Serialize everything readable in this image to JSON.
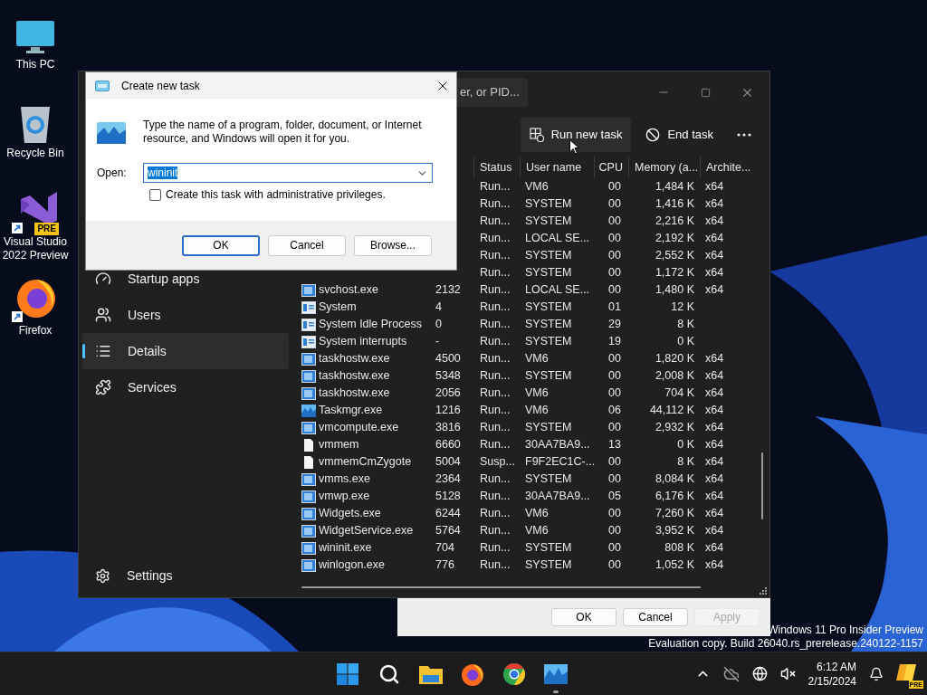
{
  "desktop_icons": [
    {
      "label": "This PC",
      "kind": "pc"
    },
    {
      "label": "Recycle Bin",
      "kind": "bin"
    },
    {
      "label": "Visual Studio 2022 Preview",
      "kind": "vs",
      "badge": "PRE"
    },
    {
      "label": "Firefox",
      "kind": "firefox"
    }
  ],
  "properties_dialog": {
    "buttons": [
      {
        "label": "OK",
        "disabled": false
      },
      {
        "label": "Cancel",
        "disabled": false
      },
      {
        "label": "Apply",
        "disabled": true
      }
    ]
  },
  "watermark": {
    "line1": "Windows 11 Pro Insider Preview",
    "line2": "Evaluation copy. Build 26040.rs_prerelease.240122-1157"
  },
  "task_manager": {
    "search": {
      "placeholder": "er, or PID..."
    },
    "toolbar": [
      {
        "kind": "run",
        "label": "Run new task",
        "hovered": true
      },
      {
        "kind": "end",
        "label": "End task",
        "hovered": false
      },
      {
        "kind": "more",
        "hovered": false
      }
    ],
    "sidebar": {
      "items": [
        {
          "kind": "startup",
          "label": "Startup apps",
          "selected": false
        },
        {
          "kind": "users",
          "label": "Users",
          "selected": false
        },
        {
          "kind": "details",
          "label": "Details",
          "selected": true
        },
        {
          "kind": "services",
          "label": "Services",
          "selected": false
        }
      ],
      "settings": "Settings"
    },
    "table": {
      "columns": [
        "Status",
        "User name",
        "CPU",
        "Memory (a...",
        "Archite..."
      ],
      "rows": [
        {
          "status": "Run...",
          "user": "VM6",
          "cpu": "00",
          "memory": "1,484 K",
          "arch": "x64"
        },
        {
          "status": "Run...",
          "user": "SYSTEM",
          "cpu": "00",
          "memory": "1,416 K",
          "arch": "x64"
        },
        {
          "status": "Run...",
          "user": "SYSTEM",
          "cpu": "00",
          "memory": "2,216 K",
          "arch": "x64"
        },
        {
          "status": "Run...",
          "user": "LOCAL SE...",
          "cpu": "00",
          "memory": "2,192 K",
          "arch": "x64"
        },
        {
          "status": "Run...",
          "user": "SYSTEM",
          "cpu": "00",
          "memory": "2,552 K",
          "arch": "x64"
        },
        {
          "status": "Run...",
          "user": "SYSTEM",
          "cpu": "00",
          "memory": "1,172 K",
          "arch": "x64"
        },
        {
          "kind": "exe",
          "name": "svchost.exe",
          "pid": "2132",
          "status": "Run...",
          "user": "LOCAL SE...",
          "cpu": "00",
          "memory": "1,480 K",
          "arch": "x64"
        },
        {
          "kind": "system",
          "name": "System",
          "pid": "4",
          "status": "Run...",
          "user": "SYSTEM",
          "cpu": "01",
          "memory": "12 K"
        },
        {
          "kind": "system",
          "name": "System Idle Process",
          "pid": "0",
          "status": "Run...",
          "user": "SYSTEM",
          "cpu": "29",
          "memory": "8 K"
        },
        {
          "kind": "system",
          "name": "System interrupts",
          "pid": "-",
          "status": "Run...",
          "user": "SYSTEM",
          "cpu": "19",
          "memory": "0 K"
        },
        {
          "kind": "exe",
          "name": "taskhostw.exe",
          "pid": "4500",
          "status": "Run...",
          "user": "VM6",
          "cpu": "00",
          "memory": "1,820 K",
          "arch": "x64"
        },
        {
          "kind": "exe",
          "name": "taskhostw.exe",
          "pid": "5348",
          "status": "Run...",
          "user": "SYSTEM",
          "cpu": "00",
          "memory": "2,008 K",
          "arch": "x64"
        },
        {
          "kind": "exe",
          "name": "taskhostw.exe",
          "pid": "2056",
          "status": "Run...",
          "user": "VM6",
          "cpu": "00",
          "memory": "704 K",
          "arch": "x64"
        },
        {
          "kind": "taskmgr",
          "name": "Taskmgr.exe",
          "pid": "1216",
          "status": "Run...",
          "user": "VM6",
          "cpu": "06",
          "memory": "44,112 K",
          "arch": "x64"
        },
        {
          "kind": "exe",
          "name": "vmcompute.exe",
          "pid": "3816",
          "status": "Run...",
          "user": "SYSTEM",
          "cpu": "00",
          "memory": "2,932 K",
          "arch": "x64"
        },
        {
          "kind": "file",
          "name": "vmmem",
          "pid": "6660",
          "status": "Run...",
          "user": "30AA7BA9...",
          "cpu": "13",
          "memory": "0 K",
          "arch": "x64"
        },
        {
          "kind": "file",
          "name": "vmmemCmZygote",
          "pid": "5004",
          "status": "Susp...",
          "user": "F9F2EC1C-...",
          "cpu": "00",
          "memory": "8 K",
          "arch": "x64"
        },
        {
          "kind": "exe",
          "name": "vmms.exe",
          "pid": "2364",
          "status": "Run...",
          "user": "SYSTEM",
          "cpu": "00",
          "memory": "8,084 K",
          "arch": "x64"
        },
        {
          "kind": "exe",
          "name": "vmwp.exe",
          "pid": "5128",
          "status": "Run...",
          "user": "30AA7BA9...",
          "cpu": "05",
          "memory": "6,176 K",
          "arch": "x64"
        },
        {
          "kind": "exe",
          "name": "Widgets.exe",
          "pid": "6244",
          "status": "Run...",
          "user": "VM6",
          "cpu": "00",
          "memory": "7,260 K",
          "arch": "x64"
        },
        {
          "kind": "exe",
          "name": "WidgetService.exe",
          "pid": "5764",
          "status": "Run...",
          "user": "VM6",
          "cpu": "00",
          "memory": "3,952 K",
          "arch": "x64"
        },
        {
          "kind": "exe",
          "name": "wininit.exe",
          "pid": "704",
          "status": "Run...",
          "user": "SYSTEM",
          "cpu": "00",
          "memory": "808 K",
          "arch": "x64"
        },
        {
          "kind": "exe",
          "name": "winlogon.exe",
          "pid": "776",
          "status": "Run...",
          "user": "SYSTEM",
          "cpu": "00",
          "memory": "1,052 K",
          "arch": "x64"
        }
      ]
    }
  },
  "run_dialog": {
    "title": "Create new task",
    "message": "Type the name of a program, folder, document, or Internet resource, and Windows will open it for you.",
    "open_label": "Open:",
    "value": "wininit",
    "value_selected": true,
    "admin_checkbox": {
      "label": "Create this task with administrative privileges.",
      "checked": false
    },
    "buttons": [
      {
        "label": "OK",
        "default": true
      },
      {
        "label": "Cancel",
        "default": false
      },
      {
        "label": "Browse...",
        "default": false
      }
    ]
  },
  "taskbar": {
    "apps": [
      {
        "kind": "start",
        "running": false
      },
      {
        "kind": "search",
        "running": false
      },
      {
        "kind": "explorer",
        "running": false
      },
      {
        "kind": "firefox",
        "running": false
      },
      {
        "kind": "chrome",
        "running": false
      },
      {
        "kind": "taskmgr",
        "running": true
      }
    ],
    "tray": [
      {
        "kind": "chevron"
      },
      {
        "kind": "cloud-off"
      },
      {
        "kind": "globe"
      },
      {
        "kind": "muted"
      }
    ],
    "time": "6:12 AM",
    "date": "2/15/2024",
    "copilot_badge": "PRE"
  }
}
